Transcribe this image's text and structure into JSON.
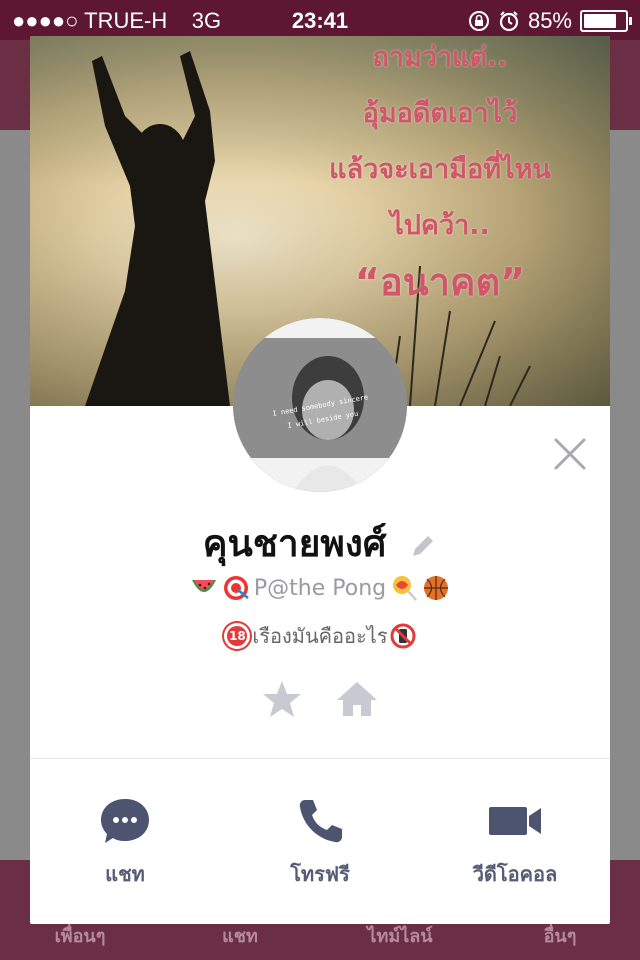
{
  "status_bar": {
    "signal": "●●●●○",
    "carrier": "TRUE-H",
    "network": "3G",
    "time": "23:41",
    "battery_pct": "85%",
    "battery_level": 0.85
  },
  "background_tabs": [
    "เพื่อนๆ",
    "แชท",
    "ไทม์ไลน์",
    "อื่นๆ"
  ],
  "cover": {
    "lines": [
      "ถามว่าแต่..",
      "อุ้มอดีตเอาไว้",
      "แล้วจะเอามือที่ไหน",
      "ไปคว้า.."
    ],
    "emphasis": "“อนาคต”",
    "avatar_text_1": "I need somebody sincere",
    "avatar_text_2": "I will beside you"
  },
  "profile": {
    "name": "คุนชายพงศ์",
    "status_message": "P@the Pong",
    "bio": "เรืองมันคืออะไร",
    "bio_badge_left": "18"
  },
  "actions": [
    {
      "label": "แชท",
      "icon": "chat-bubble-icon"
    },
    {
      "label": "โทรฟรี",
      "icon": "phone-icon"
    },
    {
      "label": "วีดีโอคอล",
      "icon": "video-camera-icon"
    }
  ],
  "colors": {
    "status_bar": "#5e1733",
    "accent": "#4c5470",
    "name": "#111111",
    "cover_text": "#d0566a"
  }
}
